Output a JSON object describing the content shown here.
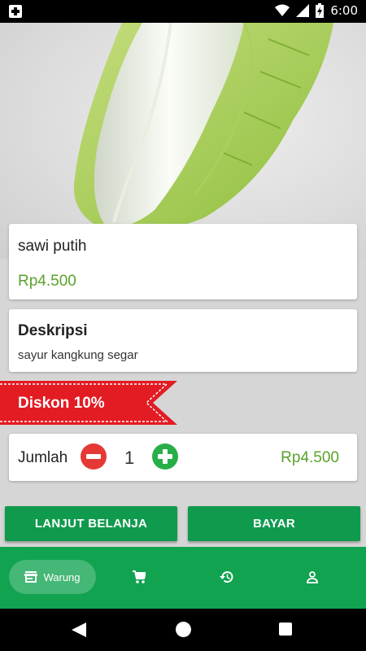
{
  "status_bar": {
    "time": "6:00"
  },
  "product": {
    "name": "sawi putih",
    "price": "Rp4.500"
  },
  "description": {
    "title": "Deskripsi",
    "text": "sayur kangkung segar"
  },
  "discount": {
    "label": "Diskon 10%"
  },
  "quantity": {
    "label": "Jumlah",
    "value": "1",
    "total": "Rp4.500"
  },
  "actions": {
    "continue_label": "LANJUT BELANJA",
    "pay_label": "BAYAR"
  },
  "bottom_nav": {
    "items": [
      {
        "label": "Warung",
        "icon": "store-icon",
        "active": true
      },
      {
        "label": "",
        "icon": "cart-icon",
        "active": false
      },
      {
        "label": "",
        "icon": "history-icon",
        "active": false
      },
      {
        "label": "",
        "icon": "profile-icon",
        "active": false
      }
    ]
  },
  "colors": {
    "primary_green": "#11a350",
    "price_green": "#5aa12b",
    "ribbon_red": "#e31b23",
    "minus_red": "#e53935"
  }
}
